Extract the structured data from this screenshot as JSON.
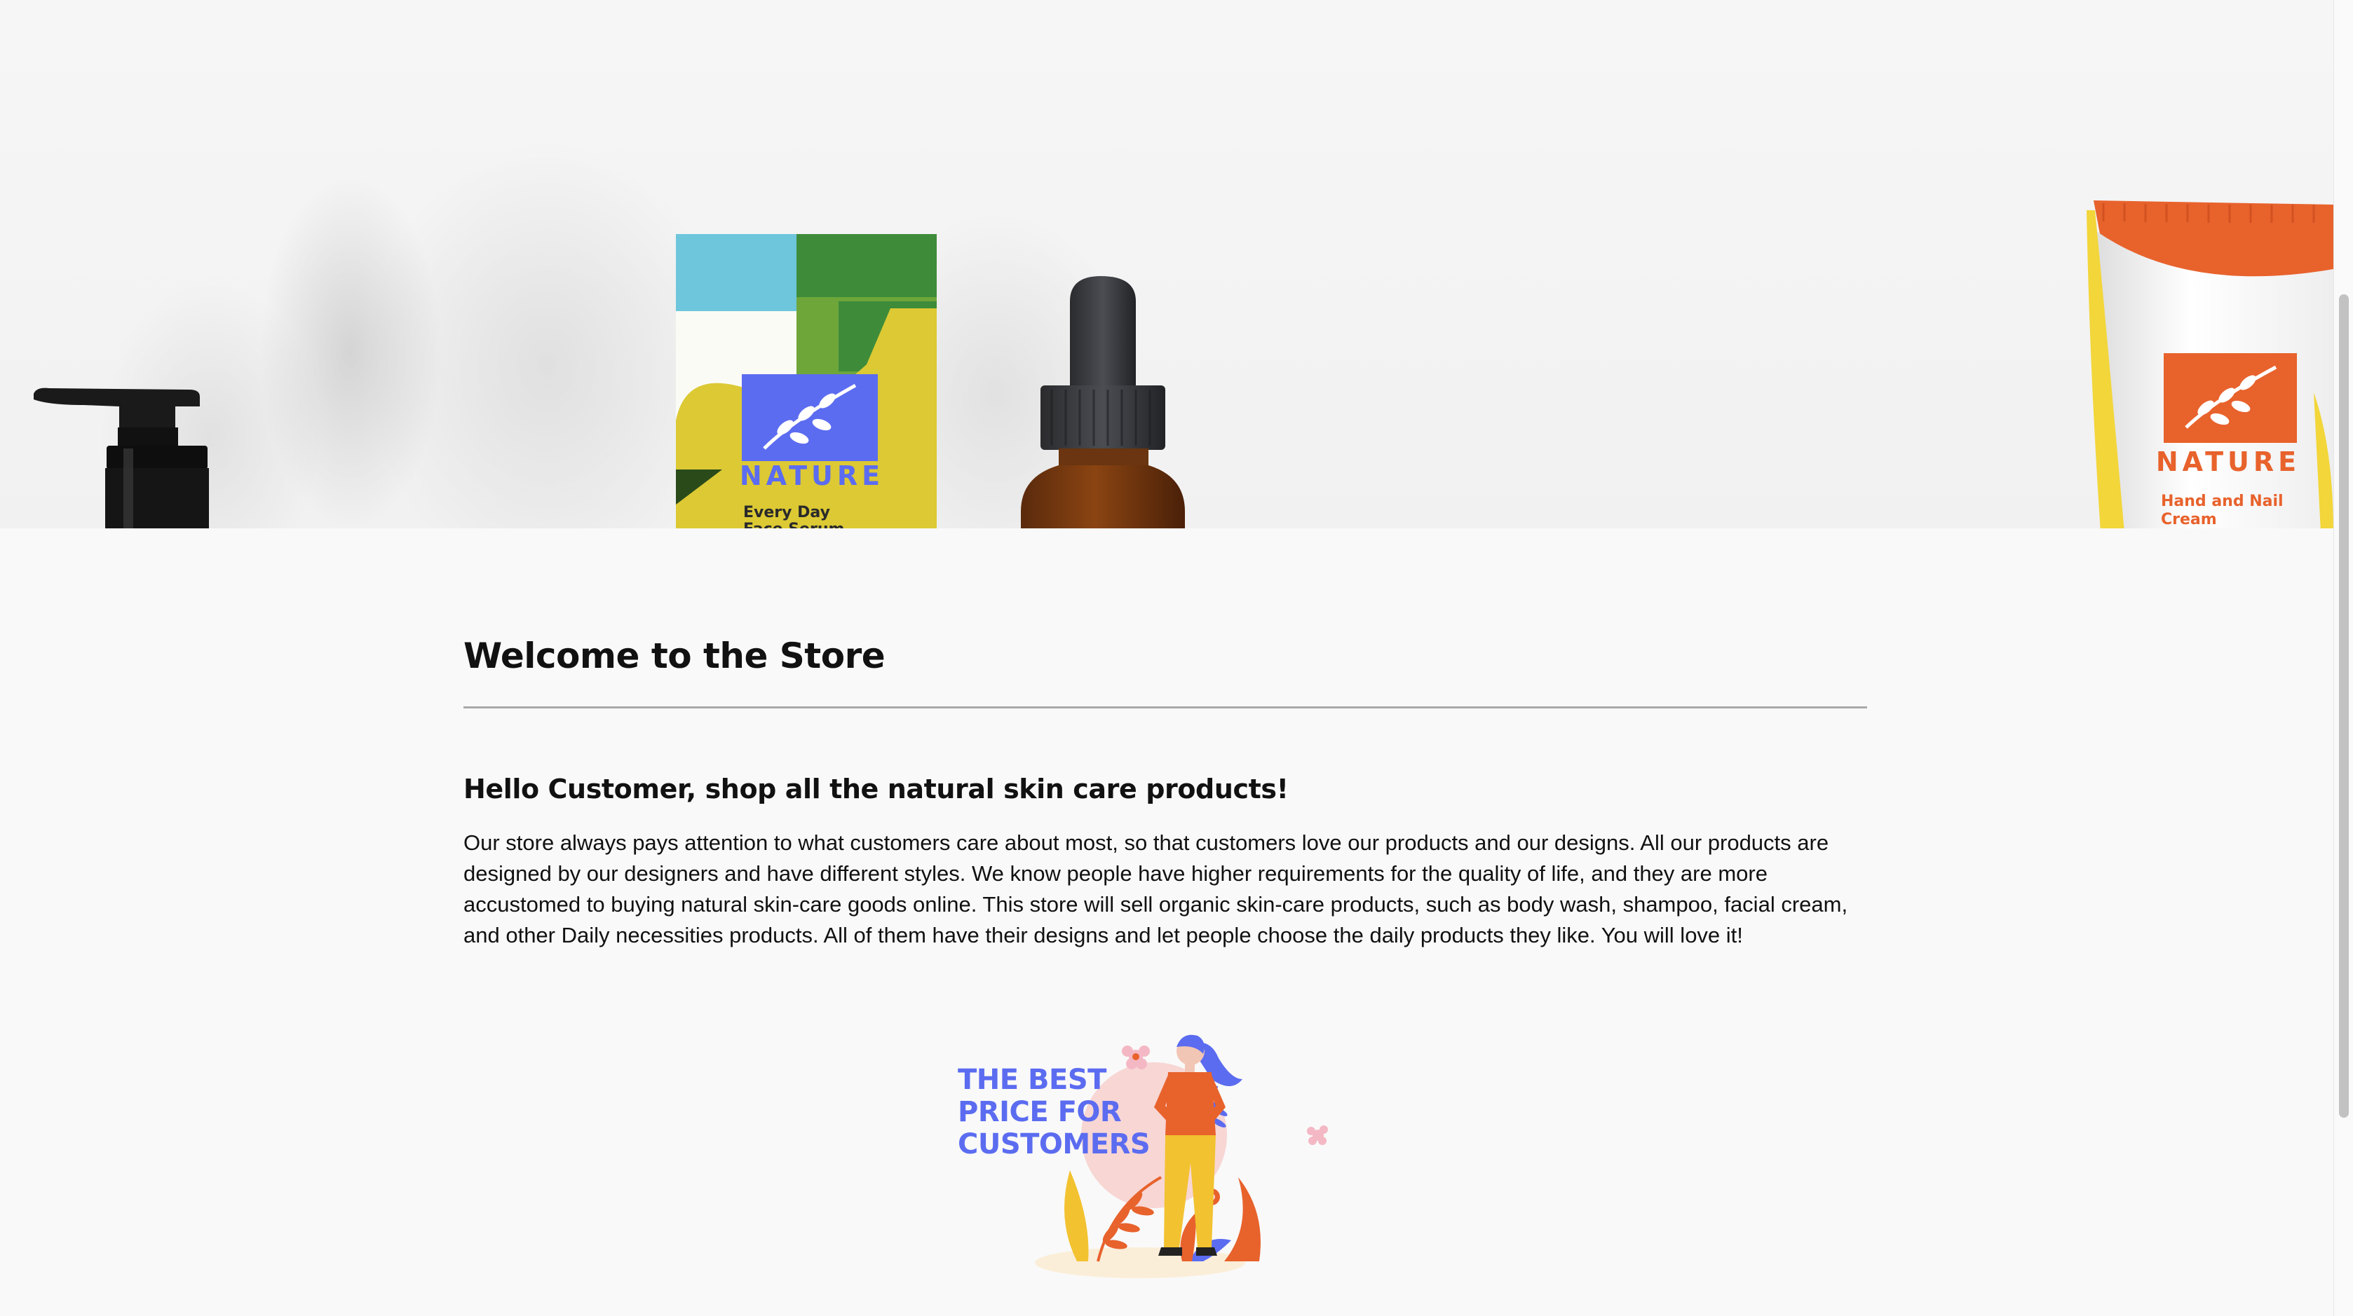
{
  "hero": {
    "serum_box": {
      "brand": "NATURE",
      "product_line1": "Every Day",
      "product_line2": "Face Serum"
    },
    "cream_tube": {
      "brand": "NATURE",
      "product_line1": "Hand and Nail",
      "product_line2": "Cream"
    }
  },
  "main": {
    "title": "Welcome to the Store",
    "subtitle": "Hello Customer, shop all the natural skin care products!",
    "paragraph": "Our store always pays attention to what customers care about most, so that customers love our products and our designs. All our products are designed by our designers and have different styles. We know people have higher requirements for the quality of life, and they are more accustomed to buying natural skin-care goods online. This store will sell organic skin-care products, such as body wash, shampoo, facial cream, and other Daily necessities products. All of them have their designs and let people choose the daily products they like. You will love it!"
  },
  "promo": {
    "line1": "THE BEST",
    "line2": "PRICE FOR",
    "line3": "CUSTOMERS"
  },
  "colors": {
    "brand_blue": "#5b6cf0",
    "brand_orange": "#e8622c",
    "page_bg": "#f9f9f9"
  }
}
